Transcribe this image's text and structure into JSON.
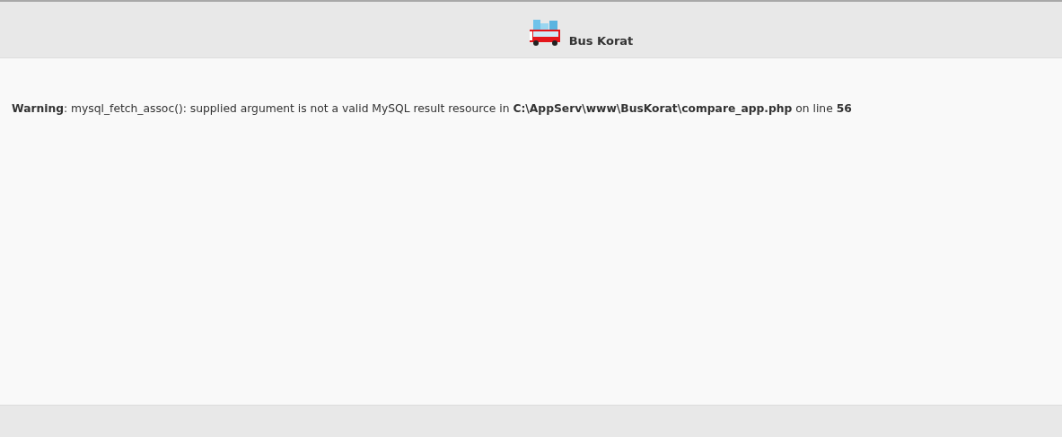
{
  "header": {
    "title": "Bus Korat"
  },
  "message": "**Warning**: mysql_fetch_assoc(): supplied argument is not a valid MySQL result resource in **C:\\AppServ\\www\\BusKorat\\compare_app.php** on line **56**"
}
